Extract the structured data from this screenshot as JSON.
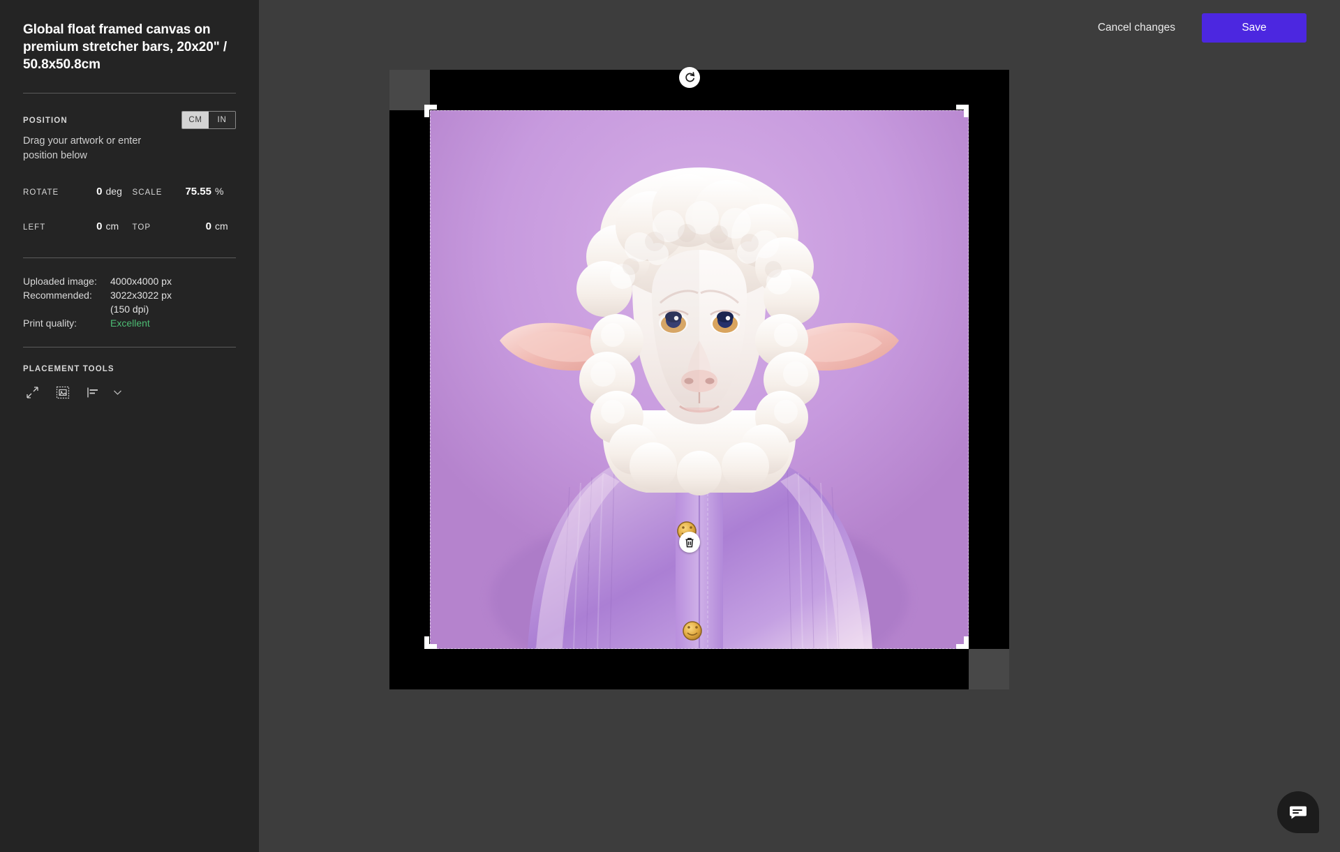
{
  "panel": {
    "title": "Global float framed canvas on premium stretcher bars, 20x20\" / 50.8x50.8cm",
    "position": {
      "label": "POSITION",
      "hint": "Drag your artwork or enter position below",
      "units": [
        {
          "id": "cm",
          "label": "CM",
          "selected": true
        },
        {
          "id": "in",
          "label": "IN",
          "selected": false
        }
      ],
      "fields": [
        {
          "name": "rotate",
          "label": "ROTATE",
          "value": "0",
          "unit": "deg"
        },
        {
          "name": "scale",
          "label": "SCALE",
          "value": "75.55",
          "unit": "%"
        },
        {
          "name": "left",
          "label": "LEFT",
          "value": "0",
          "unit": "cm"
        },
        {
          "name": "top",
          "label": "TOP",
          "value": "0",
          "unit": "cm"
        }
      ]
    },
    "info": {
      "uploaded_key": "Uploaded image:",
      "uploaded_val": "4000x4000 px",
      "recommended_key": "Recommended:",
      "recommended_val": "3022x3022 px",
      "recommended_val2": "(150 dpi)",
      "quality_key": "Print quality:",
      "quality_val": "Excellent",
      "quality_color": "#4dbd74"
    },
    "tools": {
      "label": "PLACEMENT TOOLS",
      "items": [
        {
          "name": "resize-diagonal-icon",
          "title": "Scale to fit"
        },
        {
          "name": "fit-image-to-frame-icon",
          "title": "Fit image"
        },
        {
          "name": "align-left-icon",
          "title": "Align"
        },
        {
          "name": "chevron-down-icon",
          "title": "More alignment options"
        }
      ]
    }
  },
  "topbar": {
    "cancel_label": "Cancel changes",
    "save_label": "Save",
    "save_color": "#4c27e0"
  },
  "canvas": {
    "rotate_handle": "rotate-icon",
    "delete_handle": "trash-icon",
    "artwork_alt": "Sheep wearing a lilac knitted cardigan on a light purple background",
    "frame_color": "#000000",
    "mat_color": "#484848"
  },
  "chat": {
    "icon": "chat-bubble-icon"
  }
}
